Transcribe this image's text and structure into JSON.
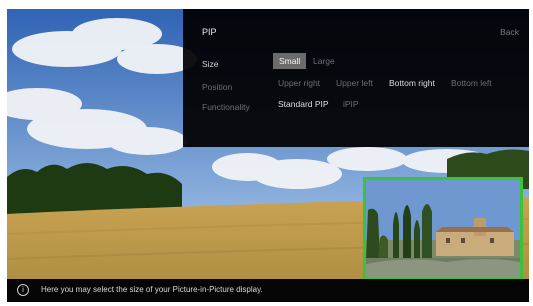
{
  "menu": {
    "title": "PIP",
    "back_label": "Back",
    "rows": {
      "size": {
        "label": "Size",
        "options": [
          "Small",
          "Large"
        ],
        "selected": "Small"
      },
      "position": {
        "label": "Position",
        "options": [
          "Upper right",
          "Upper left",
          "Bottom right",
          "Bottom left"
        ],
        "selected": "Bottom right"
      },
      "functionality": {
        "label": "Functionality",
        "options": [
          "Standard PIP",
          "iPIP"
        ],
        "selected": "Standard PIP"
      }
    }
  },
  "info_bar": {
    "icon": "info-icon",
    "message": "Here you may select the size of your Picture-in-Picture display."
  },
  "colors": {
    "pip_border": "#37c437",
    "menu_background": "#000000",
    "selected_option": "#6b6b6b"
  }
}
